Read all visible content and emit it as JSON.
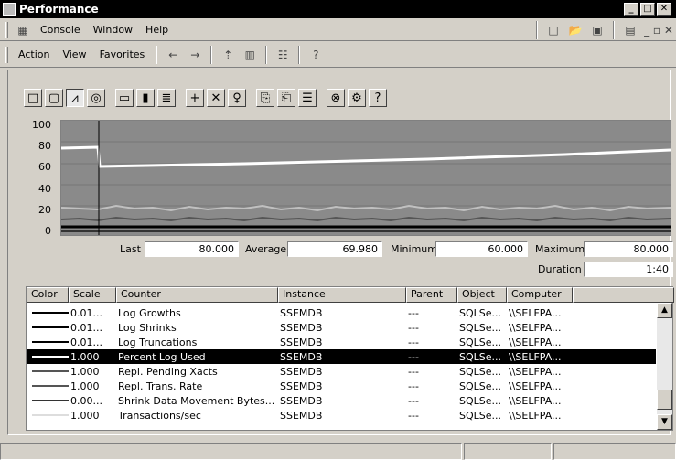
{
  "window": {
    "title": "Performance"
  },
  "menu": {
    "items": [
      {
        "label": "Console"
      },
      {
        "label": "Window"
      },
      {
        "label": "Help"
      }
    ]
  },
  "toolbar2": {
    "items": [
      {
        "label": "Action"
      },
      {
        "label": "View"
      },
      {
        "label": "Favorites"
      }
    ]
  },
  "graph": {
    "y_ticks": [
      "100",
      "80",
      "60",
      "40",
      "20",
      "0"
    ]
  },
  "stats": {
    "last_label": "Last",
    "last_value": "80.000",
    "average_label": "Average",
    "average_value": "69.980",
    "minimum_label": "Minimum",
    "minimum_value": "60.000",
    "maximum_label": "Maximum",
    "maximum_value": "80.000",
    "duration_label": "Duration",
    "duration_value": "1:40"
  },
  "table": {
    "headers": [
      "Color",
      "Scale",
      "Counter",
      "Instance",
      "Parent",
      "Object",
      "Computer"
    ],
    "rows": [
      {
        "scale": "0.01...",
        "counter": "Log Growths",
        "instance": "SSEMDB",
        "parent": "---",
        "object": "SQLSe...",
        "computer": "\\\\SELFPA...",
        "color": "#000000"
      },
      {
        "scale": "0.01...",
        "counter": "Log Shrinks",
        "instance": "SSEMDB",
        "parent": "---",
        "object": "SQLSe...",
        "computer": "\\\\SELFPA...",
        "color": "#000000"
      },
      {
        "scale": "0.01...",
        "counter": "Log Truncations",
        "instance": "SSEMDB",
        "parent": "---",
        "object": "SQLSe...",
        "computer": "\\\\SELFPA...",
        "color": "#000000"
      },
      {
        "scale": "1.000",
        "counter": "Percent Log Used",
        "instance": "SSEMDB",
        "parent": "---",
        "object": "SQLSe...",
        "computer": "\\\\SELFPA...",
        "color": "#ffffff"
      },
      {
        "scale": "1.000",
        "counter": "Repl. Pending Xacts",
        "instance": "SSEMDB",
        "parent": "---",
        "object": "SQLSe...",
        "computer": "\\\\SELFPA...",
        "color": "#555555"
      },
      {
        "scale": "1.000",
        "counter": "Repl. Trans. Rate",
        "instance": "SSEMDB",
        "parent": "---",
        "object": "SQLSe...",
        "computer": "\\\\SELFPA...",
        "color": "#555555"
      },
      {
        "scale": "0.00...",
        "counter": "Shrink Data Movement Bytes...",
        "instance": "SSEMDB",
        "parent": "---",
        "object": "SQLSe...",
        "computer": "\\\\SELFPA...",
        "color": "#333333"
      },
      {
        "scale": "1.000",
        "counter": "Transactions/sec",
        "instance": "SSEMDB",
        "parent": "---",
        "object": "SQLSe...",
        "computer": "\\\\SELFPA...",
        "color": "#dddddd"
      }
    ]
  }
}
